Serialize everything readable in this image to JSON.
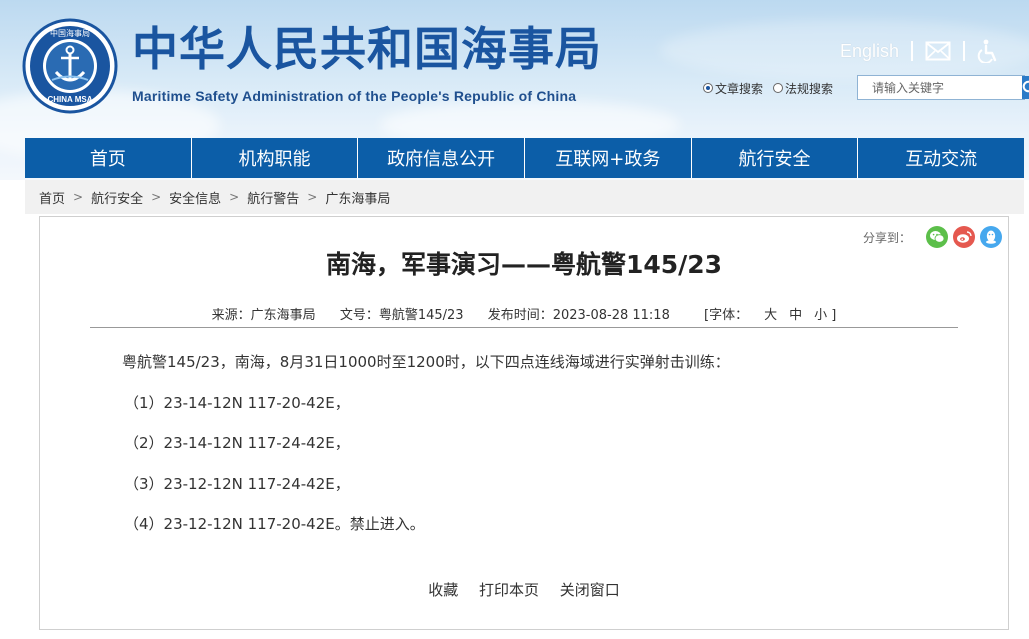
{
  "header": {
    "title": "中华人民共和国海事局",
    "subtitle": "Maritime Safety Administration of the People's Republic of China",
    "logo_text_top": "中国海事局",
    "logo_text_bottom": "CHINA MSA",
    "english_link": "English",
    "icons": [
      "mail-icon",
      "accessibility-icon"
    ]
  },
  "search": {
    "options": [
      {
        "label": "文章搜索",
        "selected": true
      },
      {
        "label": "法规搜索",
        "selected": false
      }
    ],
    "placeholder": "请输入关键字"
  },
  "nav": {
    "items": [
      "首页",
      "机构职能",
      "政府信息公开",
      "互联网+政务",
      "航行安全",
      "互动交流"
    ]
  },
  "breadcrumb": {
    "items": [
      "首页",
      "航行安全",
      "安全信息",
      "航行警告",
      "广东海事局"
    ],
    "separator": ">"
  },
  "article": {
    "share_label": "分享到：",
    "share_icons": [
      "wechat-icon",
      "weibo-icon",
      "qq-icon"
    ],
    "title": "南海，军事演习——粤航警145/23",
    "meta": {
      "source": "来源：广东海事局",
      "doc_no": "文号：粤航警145/23",
      "published": "发布时间：2023-08-28 11:18",
      "font_label": "[字体：",
      "font_large": "大",
      "font_medium": "中",
      "font_small": "小 ]"
    },
    "intro": "粤航警145/23，南海，8月31日1000时至1200时，以下四点连线海域进行实弹射击训练：",
    "points": [
      "（1）23-14-12N 117-20-42E，",
      "（2）23-14-12N 117-24-42E，",
      "（3）23-12-12N 117-24-42E，",
      "（4）23-12-12N 117-20-42E。禁止进入。"
    ],
    "actions": [
      "收藏",
      "打印本页",
      "关闭窗口"
    ]
  },
  "colors": {
    "nav_bg": "#0c5ea8",
    "title_blue": "#1a55a0",
    "search_btn": "#2b7bc8",
    "wechat": "#5cbf4a",
    "weibo": "#e5584f",
    "qq": "#46a8ee"
  }
}
